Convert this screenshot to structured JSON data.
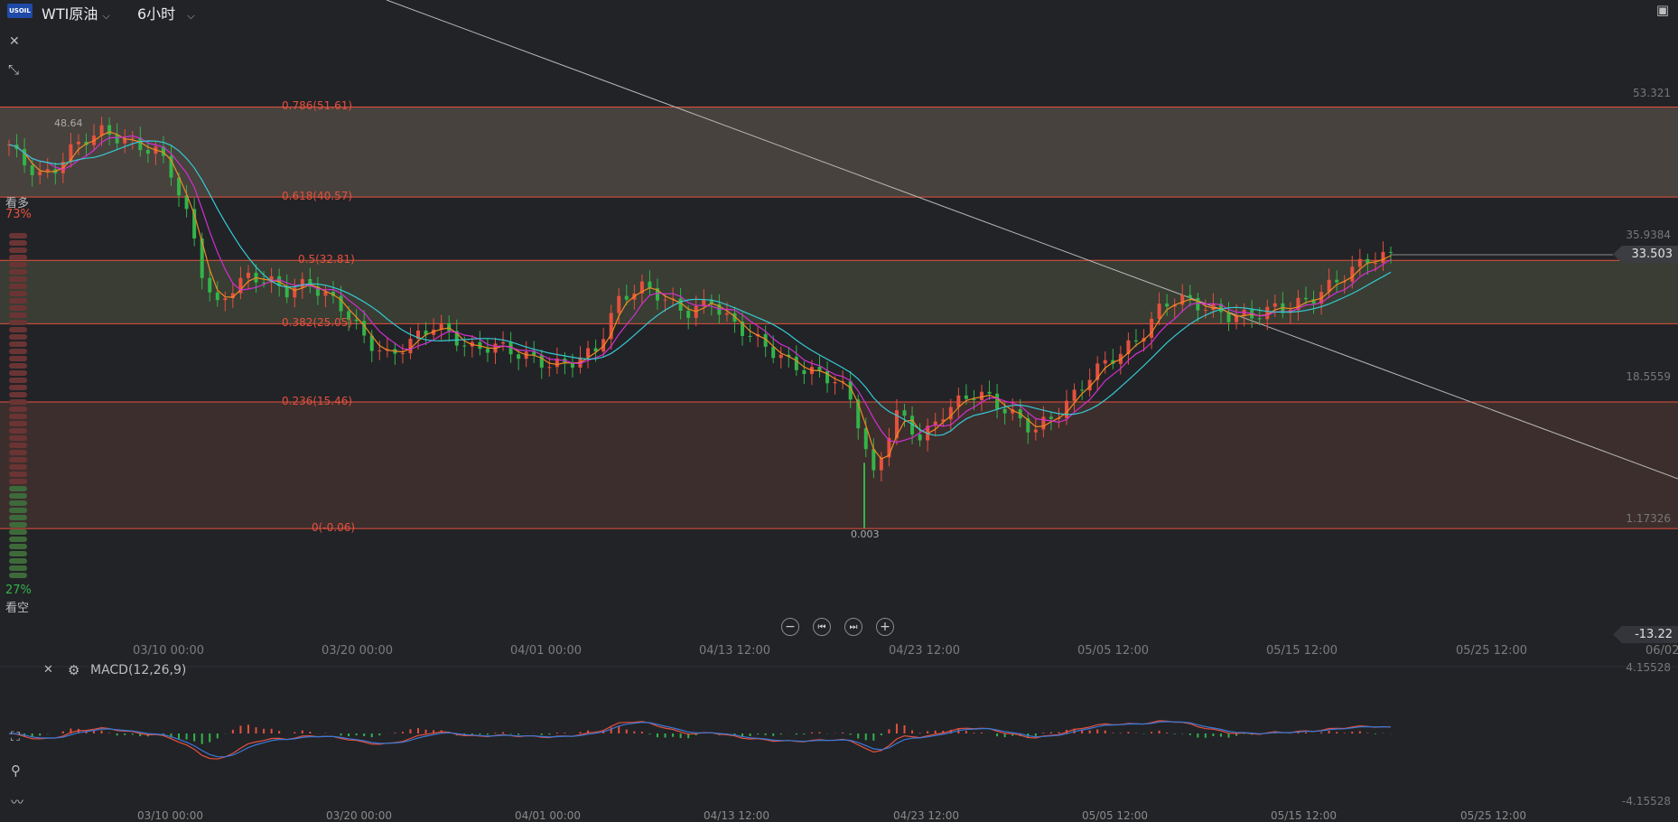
{
  "header": {
    "logo_text": "USOIL",
    "symbol": "WTI原油",
    "timeframe": "6小时",
    "dropdown_glyph": "⌵"
  },
  "icons": {
    "close": "✕",
    "shrink": "⤡",
    "panel": "▣",
    "indicator": "📊",
    "draw": "⚲",
    "pulse": "〰"
  },
  "sentiment": {
    "bull_label": "看多",
    "bull_pct": "73%",
    "bear_label": "看空",
    "bear_pct": "27%",
    "bull_fraction": 0.73
  },
  "fib_levels": [
    {
      "label": "0.786(51.61)",
      "value": 51.61
    },
    {
      "label": "0.618(40.57)",
      "value": 40.57
    },
    {
      "label": "0.5(32.81)",
      "value": 32.81
    },
    {
      "label": "0.382(25.05)",
      "value": 25.05
    },
    {
      "label": "0.236(15.46)",
      "value": 15.46
    },
    {
      "label": "0(-0.06)",
      "value": -0.06
    }
  ],
  "annotations": {
    "high_label": "48.64",
    "low_label": "0.003"
  },
  "price_axis": [
    "53.321",
    "35.9384",
    "18.5559",
    "1.17326"
  ],
  "current_price": "33.503",
  "macd_current": "-13.22",
  "macd_axis": {
    "top": "4.15528",
    "bottom": "-4.15528"
  },
  "time_axis": [
    "03/10 00:00",
    "03/20 00:00",
    "04/01 00:00",
    "04/13 12:00",
    "04/23 12:00",
    "05/05 12:00",
    "05/15 12:00",
    "05/25 12:00",
    "06/02"
  ],
  "macd_panel": {
    "name": "MACD(12,26,9)"
  },
  "zoom_controls": [
    "−",
    "⏮",
    "⏭",
    "+"
  ],
  "colors": {
    "up": "#e4513e",
    "down": "#33b449",
    "fib_line": "#e4513e",
    "ma_fast": "#f08a24",
    "ma_mid": "#d12fd1",
    "ma_slow": "#35c9d3",
    "macd_dif": "#e4513e",
    "macd_dea": "#3a78d8"
  },
  "chart_data": {
    "type": "candlestick",
    "close_path": [
      47,
      45,
      44,
      43,
      44,
      46,
      47,
      48,
      48.6,
      48.2,
      47.5,
      47,
      46.5,
      46,
      44,
      40,
      36,
      30,
      27,
      29,
      30,
      31,
      30.5,
      30,
      29,
      29.5,
      30,
      29,
      28,
      27,
      25,
      23,
      22,
      21,
      22,
      23,
      24,
      25,
      24,
      23,
      22,
      22,
      22.5,
      22,
      21.5,
      21,
      20.5,
      20,
      20,
      20.5,
      21,
      22,
      25,
      28,
      29,
      29.5,
      29,
      28,
      27,
      26.5,
      27,
      28,
      26,
      25,
      24,
      23,
      22,
      21,
      20,
      19.5,
      19,
      18.5,
      18,
      16,
      12,
      6,
      10,
      14,
      13,
      11,
      12,
      14,
      15,
      16,
      16.5,
      16,
      15,
      14,
      13,
      12,
      13,
      14,
      15.5,
      17,
      19,
      20,
      21,
      22,
      23,
      25,
      27,
      28,
      28,
      27.5,
      27,
      26.5,
      26,
      26,
      26,
      26.5,
      27,
      27,
      27.5,
      28,
      29,
      30,
      31,
      32,
      33,
      33,
      33.5
    ]
  }
}
